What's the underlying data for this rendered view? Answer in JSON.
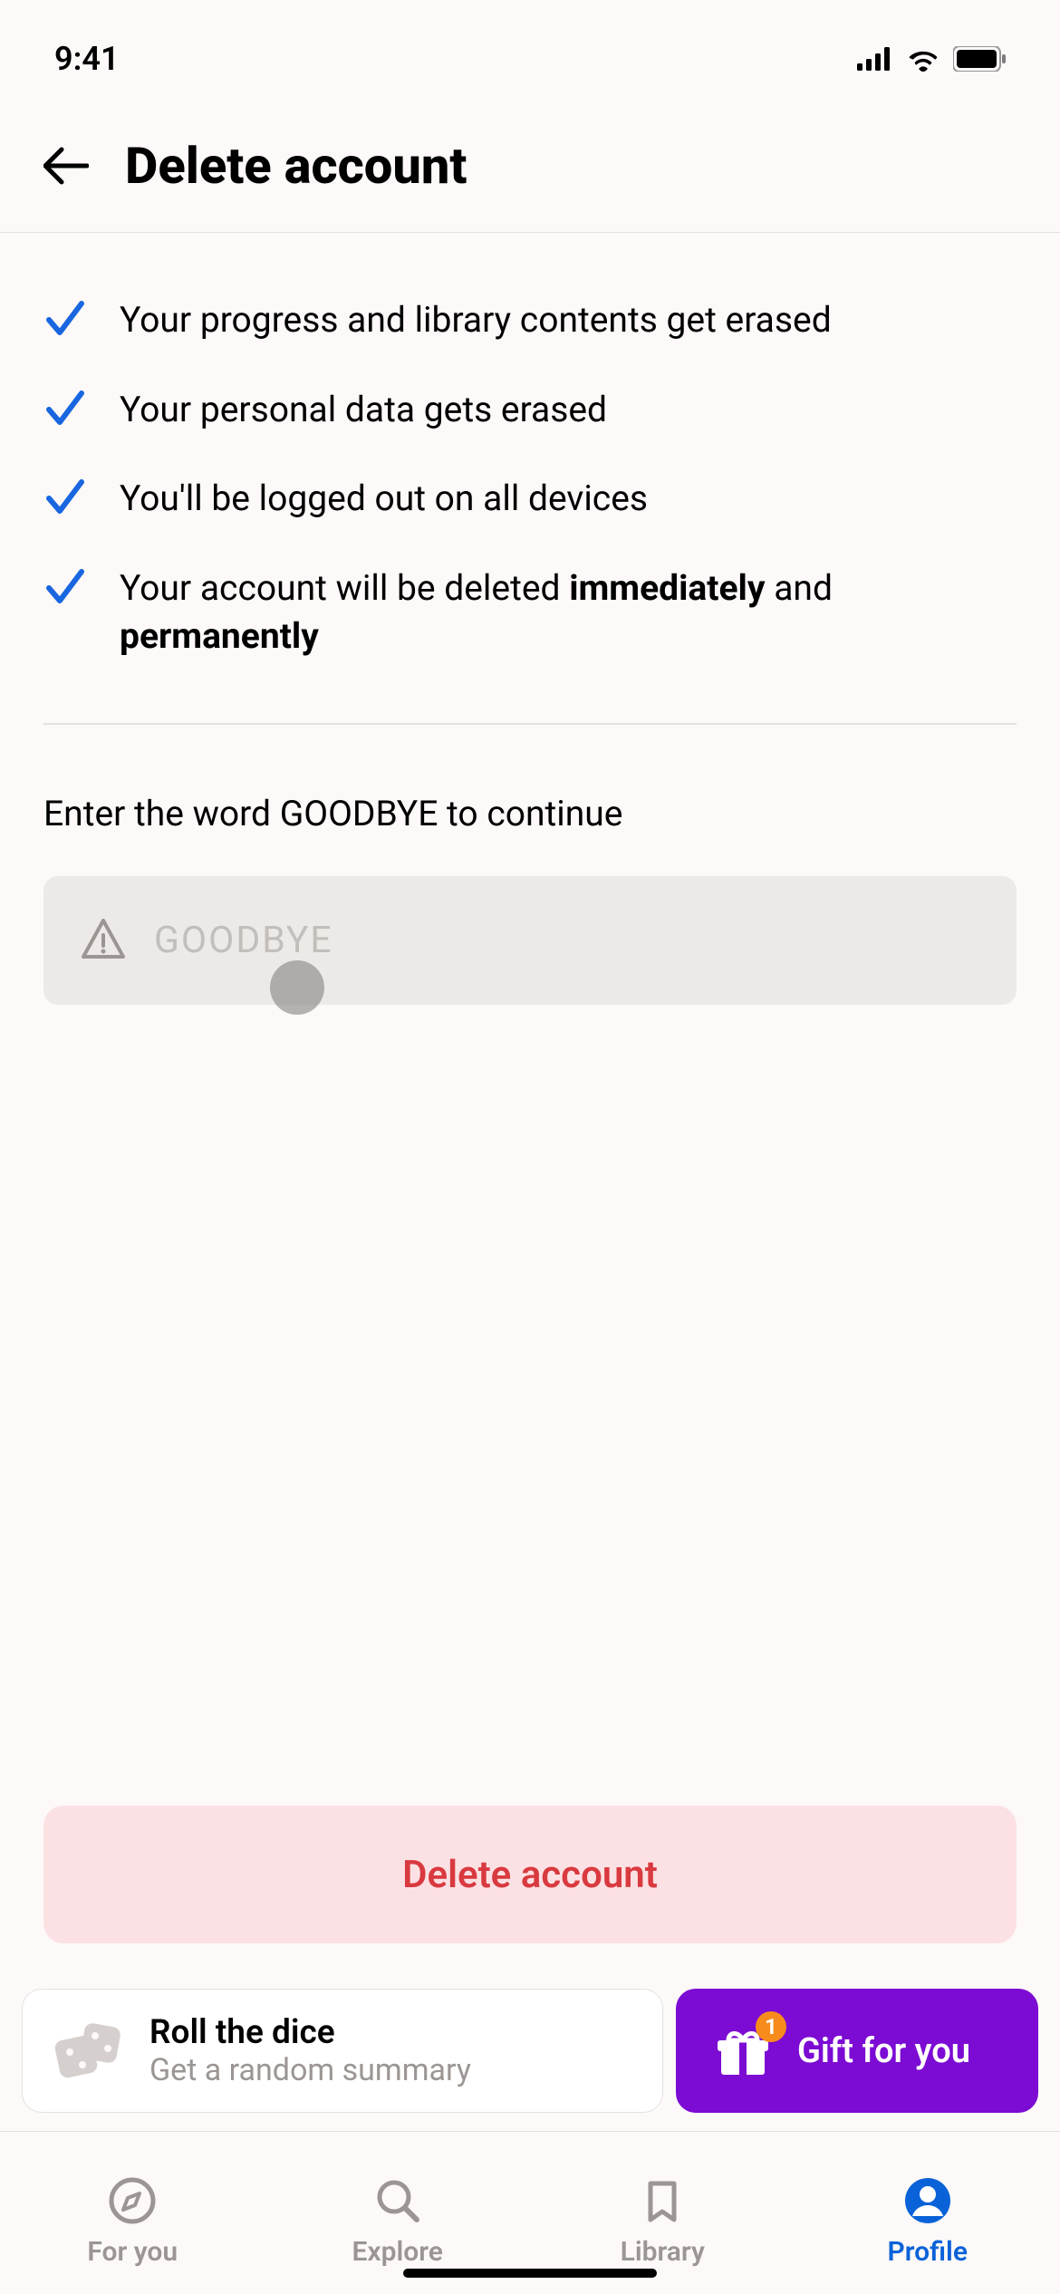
{
  "status_bar": {
    "time": "9:41"
  },
  "header": {
    "title": "Delete account"
  },
  "bullets": [
    {
      "text": "Your progress and library contents get erased",
      "bold_parts": []
    },
    {
      "text": "Your personal data gets erased",
      "bold_parts": []
    },
    {
      "text": "You'll be logged out on all devices",
      "bold_parts": []
    },
    {
      "text_html": "Your account will be deleted <b>immediately</b> and <b>permanently</b>"
    }
  ],
  "instruction": "Enter the word GOODBYE to continue",
  "input": {
    "placeholder": "GOODBYE",
    "value": ""
  },
  "delete_button": "Delete account",
  "promo": {
    "roll_title": "Roll the dice",
    "roll_subtitle": "Get a random summary",
    "gift_label": "Gift for you",
    "gift_badge": "1"
  },
  "tabs": {
    "for_you": "For you",
    "explore": "Explore",
    "library": "Library",
    "profile": "Profile"
  },
  "colors": {
    "accent_blue": "#0A62D8",
    "accent_purple": "#7C0BD3",
    "danger": "#D93A3F",
    "danger_bg": "#FCE1E4",
    "check": "#1866E0"
  }
}
